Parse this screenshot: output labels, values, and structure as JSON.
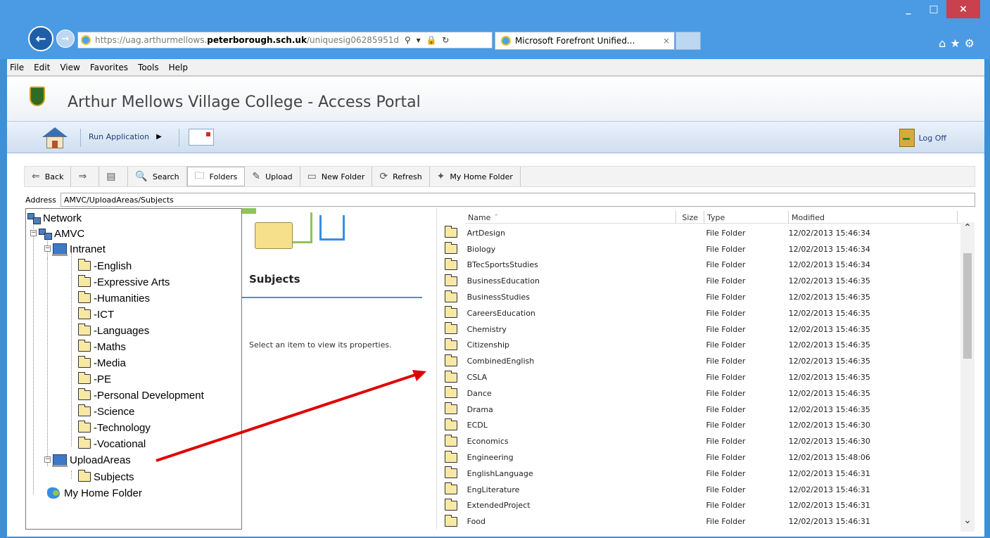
{
  "browser": {
    "url_prefix": "https://uag.arthurmellows.",
    "url_domain": "peterborough.sch.uk",
    "url_suffix": "/uniquesig06285951d",
    "tab_title": "Microsoft Forefront Unified...",
    "tab_close": "×",
    "menu": [
      "File",
      "Edit",
      "View",
      "Favorites",
      "Tools",
      "Help"
    ]
  },
  "portal": {
    "title": "Arthur Mellows Village College - Access Portal",
    "run_application": "Run Application",
    "log_off": "Log Off"
  },
  "toolbar": {
    "back": "Back",
    "search": "Search",
    "folders": "Folders",
    "upload": "Upload",
    "new_folder": "New Folder",
    "refresh": "Refresh",
    "my_home_folder": "My Home Folder"
  },
  "address": {
    "label": "Address",
    "value": "AMVC/UploadAreas/Subjects"
  },
  "tree": {
    "network": "Network",
    "amvc": "AMVC",
    "intranet": "Intranet",
    "intranet_children": [
      "-English",
      "-Expressive Arts",
      "-Humanities",
      "-ICT",
      "-Languages",
      "-Maths",
      "-Media",
      "-PE",
      "-Personal Development",
      "-Science",
      "-Technology",
      "-Vocational"
    ],
    "upload_areas": "UploadAreas",
    "subjects": "Subjects",
    "my_home_folder": "My Home Folder"
  },
  "properties": {
    "title": "Subjects",
    "hint": "Select an item to view its properties."
  },
  "list": {
    "headers": {
      "name": "Name",
      "size": "Size",
      "type": "Type",
      "modified": "Modified"
    },
    "rows": [
      {
        "name": "ArtDesign",
        "type": "File Folder",
        "modified": "12/02/2013 15:46:34"
      },
      {
        "name": "Biology",
        "type": "File Folder",
        "modified": "12/02/2013 15:46:34"
      },
      {
        "name": "BTecSportsStudies",
        "type": "File Folder",
        "modified": "12/02/2013 15:46:34"
      },
      {
        "name": "BusinessEducation",
        "type": "File Folder",
        "modified": "12/02/2013 15:46:35"
      },
      {
        "name": "BusinessStudies",
        "type": "File Folder",
        "modified": "12/02/2013 15:46:35"
      },
      {
        "name": "CareersEducation",
        "type": "File Folder",
        "modified": "12/02/2013 15:46:35"
      },
      {
        "name": "Chemistry",
        "type": "File Folder",
        "modified": "12/02/2013 15:46:35"
      },
      {
        "name": "Citizenship",
        "type": "File Folder",
        "modified": "12/02/2013 15:46:35"
      },
      {
        "name": "CombinedEnglish",
        "type": "File Folder",
        "modified": "12/02/2013 15:46:35"
      },
      {
        "name": "CSLA",
        "type": "File Folder",
        "modified": "12/02/2013 15:46:35"
      },
      {
        "name": "Dance",
        "type": "File Folder",
        "modified": "12/02/2013 15:46:35"
      },
      {
        "name": "Drama",
        "type": "File Folder",
        "modified": "12/02/2013 15:46:35"
      },
      {
        "name": "ECDL",
        "type": "File Folder",
        "modified": "12/02/2013 15:46:30"
      },
      {
        "name": "Economics",
        "type": "File Folder",
        "modified": "12/02/2013 15:46:30"
      },
      {
        "name": "Engineering",
        "type": "File Folder",
        "modified": "12/02/2013 15:48:06"
      },
      {
        "name": "EnglishLanguage",
        "type": "File Folder",
        "modified": "12/02/2013 15:46:31"
      },
      {
        "name": "EngLiterature",
        "type": "File Folder",
        "modified": "12/02/2013 15:46:31"
      },
      {
        "name": "ExtendedProject",
        "type": "File Folder",
        "modified": "12/02/2013 15:46:31"
      },
      {
        "name": "Food",
        "type": "File Folder",
        "modified": "12/02/2013 15:46:31"
      }
    ]
  },
  "colors": {
    "chrome_blue": "#4a9be3",
    "annotation_arrow": "#e00000",
    "folder_fill": "#f7e9a4"
  }
}
